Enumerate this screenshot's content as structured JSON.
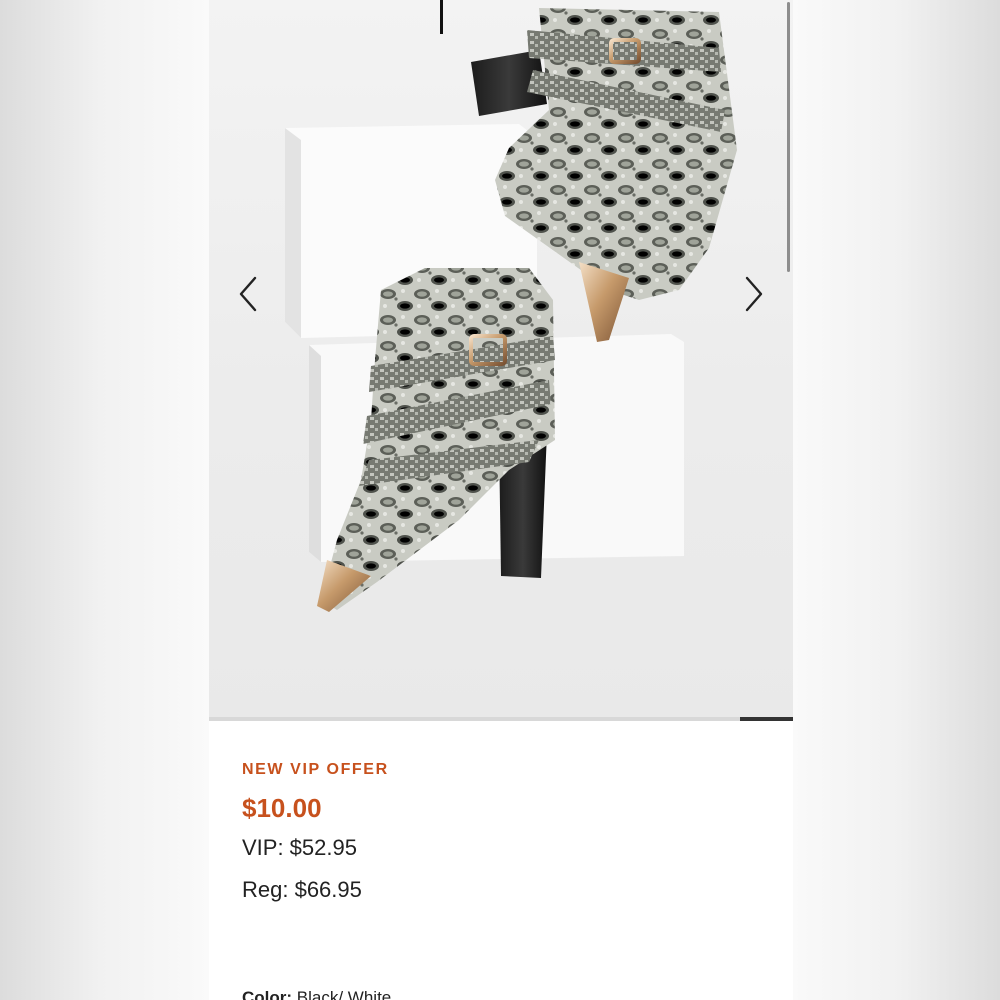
{
  "gallery": {
    "prev_icon": "chevron-left-icon",
    "next_icon": "chevron-right-icon",
    "image_alt": "Snakeskin print ankle boots with gold metal toe caps",
    "slide_progress": 0.09
  },
  "product": {
    "offer_label": "NEW VIP OFFER",
    "offer_price": "$10.00",
    "vip_price": "VIP: $52.95",
    "reg_price": "Reg: $66.95",
    "color_label": "Color:",
    "color_value": "Black/ White"
  },
  "colors": {
    "accent": "#c7511d",
    "text": "#222222",
    "background": "#ffffff"
  }
}
